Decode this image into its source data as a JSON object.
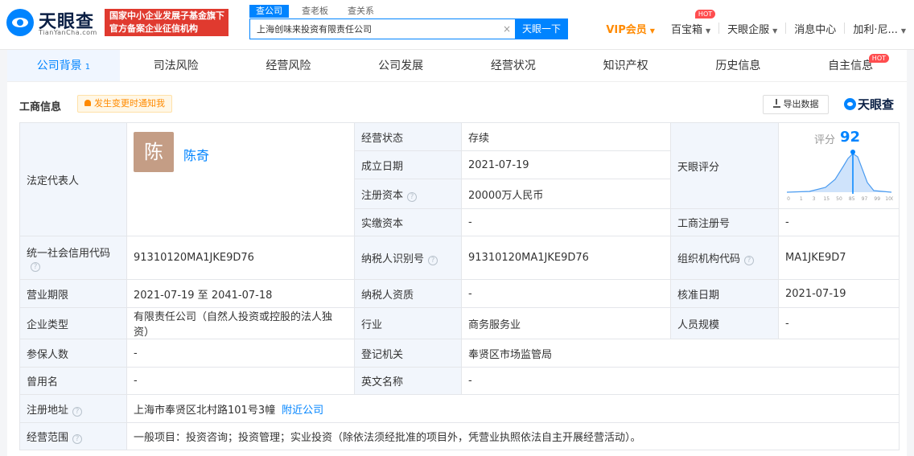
{
  "header": {
    "logo_text": "天眼查",
    "logo_sub": "TianYanCha.com",
    "badge_line1": "国家中小企业发展子基金旗下",
    "badge_line2": "官方备案企业征信机构",
    "search_tabs": [
      "查公司",
      "查老板",
      "查关系"
    ],
    "search_value": "上海创味来投资有限责任公司",
    "search_button": "天眼一下",
    "vip": "VIP会员",
    "nav": {
      "baibaoxiang": "百宝箱",
      "hot": "HOT",
      "enterprise": "天眼企服",
      "messages": "消息中心",
      "user": "加利·尼..."
    }
  },
  "tabs": [
    {
      "label": "公司背景",
      "count": "1"
    },
    {
      "label": "司法风险"
    },
    {
      "label": "经营风险"
    },
    {
      "label": "公司发展"
    },
    {
      "label": "经营状况"
    },
    {
      "label": "知识产权"
    },
    {
      "label": "历史信息"
    },
    {
      "label": "自主信息",
      "hot": "HOT"
    }
  ],
  "panel": {
    "title": "工商信息",
    "notify": "发生变更时通知我",
    "export": "导出数据",
    "brand": "天眼查"
  },
  "info": {
    "legal_rep_label": "法定代表人",
    "legal_rep_avatar": "陈",
    "legal_rep_name": "陈奇",
    "status_label": "经营状态",
    "status_value": "存续",
    "established_label": "成立日期",
    "established_value": "2021-07-19",
    "reg_capital_label": "注册资本",
    "reg_capital_value": "20000万人民币",
    "paid_capital_label": "实缴资本",
    "paid_capital_value": "-",
    "score_label": "天眼评分",
    "score_text": "评分",
    "score_value": "92",
    "reg_no_label": "工商注册号",
    "reg_no_value": "-",
    "credit_code_label": "统一社会信用代码",
    "credit_code_value": "91310120MA1JKE9D76",
    "taxpayer_id_label": "纳税人识别号",
    "taxpayer_id_value": "91310120MA1JKE9D76",
    "org_code_label": "组织机构代码",
    "org_code_value": "MA1JKE9D7",
    "term_label": "营业期限",
    "term_value": "2021-07-19  至 2041-07-18",
    "taxpayer_qual_label": "纳税人资质",
    "taxpayer_qual_value": "-",
    "approval_label": "核准日期",
    "approval_value": "2021-07-19",
    "type_label": "企业类型",
    "type_value": "有限责任公司（自然人投资或控股的法人独资）",
    "industry_label": "行业",
    "industry_value": "商务服务业",
    "staff_label": "人员规模",
    "staff_value": "-",
    "insured_label": "参保人数",
    "insured_value": "-",
    "authority_label": "登记机关",
    "authority_value": "奉贤区市场监管局",
    "former_name_label": "曾用名",
    "former_name_value": "-",
    "english_name_label": "英文名称",
    "english_name_value": "-",
    "address_label": "注册地址",
    "address_value": "上海市奉贤区北村路101号3幢",
    "nearby_link": "附近公司",
    "scope_label": "经营范围",
    "scope_value": "一般项目：投资咨询；投资管理；实业投资（除依法须经批准的项目外，凭营业执照依法自主开展经营活动）。"
  },
  "score_chart": {
    "ticks": [
      "0",
      "1",
      "3",
      "15",
      "50",
      "85",
      "97",
      "99",
      "100"
    ],
    "marker": 92,
    "colors": {
      "fill": "#cfe3fb",
      "line": "#4a9bf0"
    }
  },
  "colors": {
    "accent": "#0084ff",
    "vip": "#ff8a00",
    "badge": "#e03a2f",
    "label_bg": "#f2f6fc"
  }
}
